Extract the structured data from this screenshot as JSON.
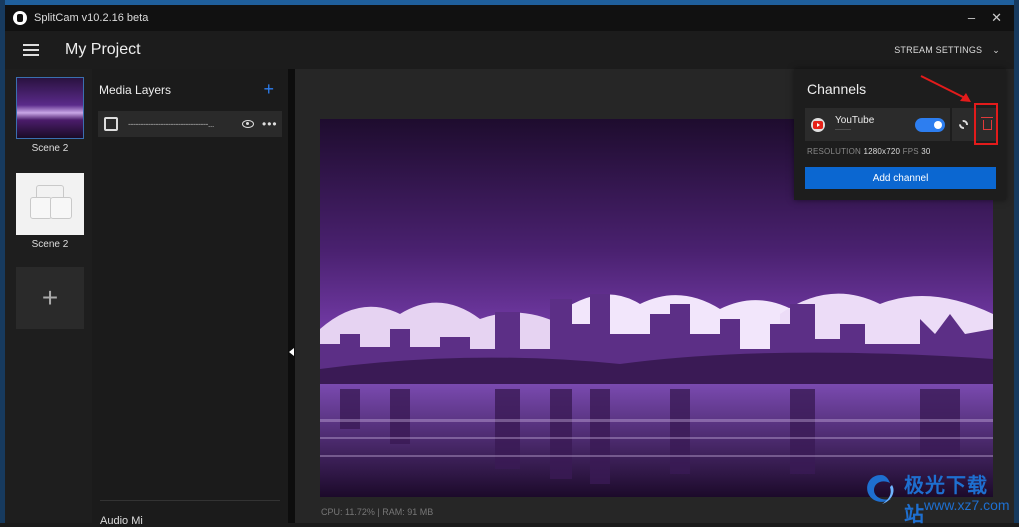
{
  "window": {
    "title": "SplitCam v10.2.16 beta",
    "minimize": "–",
    "close": "✕"
  },
  "header": {
    "project_title": "My Project",
    "stream_settings": "STREAM SETTINGS",
    "stream_settings_chevron": "⌄"
  },
  "scenes": {
    "items": [
      {
        "label": "Scene 2",
        "selected": true
      },
      {
        "label": "Scene 2",
        "selected": false
      }
    ],
    "add_label": "+"
  },
  "layers": {
    "title": "Media Layers",
    "add_label": "+",
    "items": [
      {
        "name": "--------------------------------..."
      }
    ],
    "more": "•••"
  },
  "audio_mixer": {
    "title": "Audio Mi"
  },
  "preview": {
    "stats": "CPU: 11.72% | RAM: 91 MB"
  },
  "channels": {
    "title": "Channels",
    "items": [
      {
        "name": "YouTube",
        "sub": "--------",
        "enabled": true
      }
    ],
    "resolution_label": "RESOLUTION",
    "resolution_value": "1280x720",
    "fps_label": "FPS",
    "fps_value": "30",
    "add_button": "Add channel"
  },
  "watermark": {
    "title": "极光下载站",
    "url": "www.xz7.com"
  },
  "colors": {
    "accent": "#0b67d1",
    "delete_red": "#e31b1b",
    "toggle_on": "#2d7ef0"
  }
}
